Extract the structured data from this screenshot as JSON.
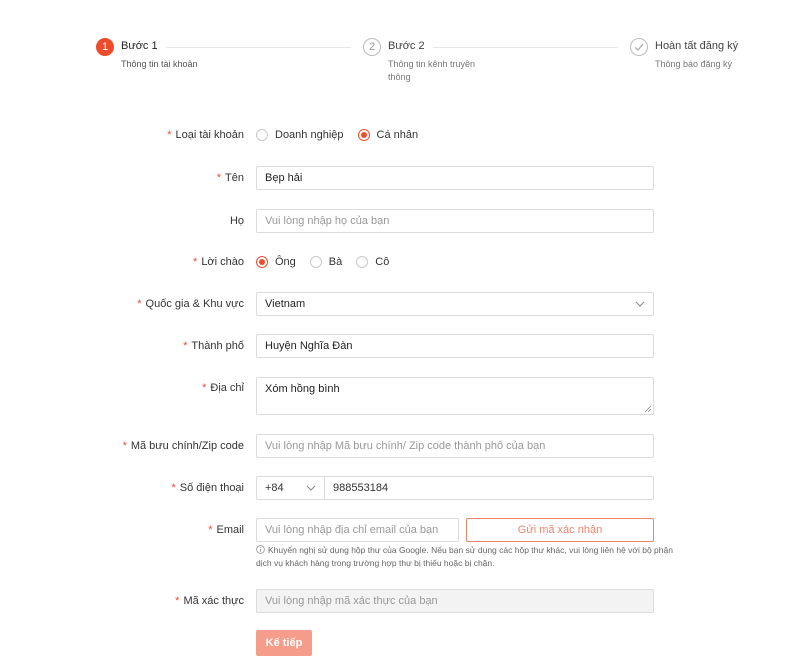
{
  "steps": [
    {
      "number": "1",
      "title": "Bước 1",
      "desc": "Thông tin tài khoản"
    },
    {
      "number": "2",
      "title": "Bước 2",
      "desc": "Thông tin kênh truyền thông"
    },
    {
      "title": "Hoàn tất đăng ký",
      "desc": "Thông báo đăng ký"
    }
  ],
  "form": {
    "account_type": {
      "label": "Loại tài khoản",
      "options": [
        "Doanh nghiệp",
        "Cá nhân"
      ],
      "selected": "Cá nhân"
    },
    "first_name": {
      "label": "Tên",
      "value": "Bẹp hải"
    },
    "last_name": {
      "label": "Họ",
      "placeholder": "Vui lòng nhập họ của bạn"
    },
    "salutation": {
      "label": "Lời chào",
      "options": [
        "Ông",
        "Bà",
        "Cô"
      ],
      "selected": "Ông"
    },
    "country": {
      "label": "Quốc gia & Khu vực",
      "value": "Vietnam"
    },
    "city": {
      "label": "Thành phố",
      "value": "Huyện Nghĩa Đàn"
    },
    "address": {
      "label": "Địa chỉ",
      "value": "Xóm hồng bình"
    },
    "zip": {
      "label": "Mã bưu chính/Zip code",
      "placeholder": "Vui lòng nhập Mã bưu chính/ Zip code thành phố của bạn"
    },
    "phone": {
      "label": "Số điện thoại",
      "code": "+84",
      "value": "988553184"
    },
    "email": {
      "label": "Email",
      "placeholder": "Vui lòng nhập địa chỉ email của bạn",
      "send_code_label": "Gửi mã xác nhận",
      "hint": "Khuyến nghị sử dụng hộp thư của Google. Nếu bạn sử dụng các hộp thư khác, vui lòng liên hệ với bộ phận dịch vụ khách hàng trong trường hợp thư bị thiếu hoặc bị chặn."
    },
    "verify_code": {
      "label": "Mã xác thực",
      "placeholder": "Vui lòng nhập mã xác thực của bạn"
    },
    "next_label": "Kế tiếp"
  },
  "colors": {
    "accent": "#ee4d2d",
    "accent_light": "#f59c8a"
  }
}
